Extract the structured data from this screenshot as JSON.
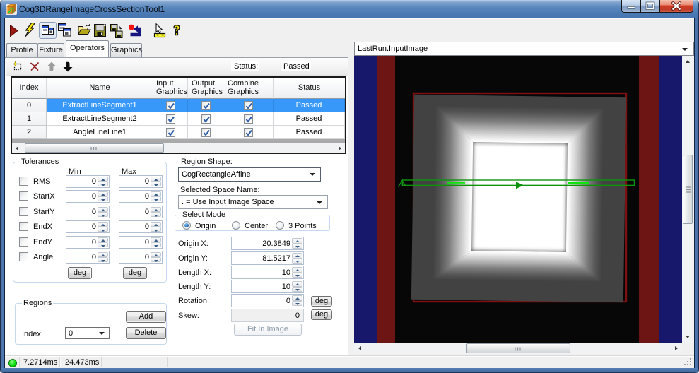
{
  "window": {
    "title": "Cog3DRangeImageCrossSectionTool1",
    "controls": [
      "minimize",
      "maximize",
      "close"
    ]
  },
  "toolbar": {
    "icons": [
      "run-icon",
      "electric-run-icon",
      "show-result-toggle-icon",
      "float-windows-icon",
      "open-icon",
      "save-icon",
      "save-as-icon",
      "reset-icon",
      "customize-toolbar-icon",
      "help-icon"
    ]
  },
  "tabs": {
    "items": [
      "Profile",
      "Fixture",
      "Operators",
      "Graphics"
    ],
    "selected": "Operators"
  },
  "operators_bar": {
    "icons": [
      "add-operator-icon",
      "delete-operator-icon",
      "move-up-icon",
      "move-down-icon"
    ],
    "status_label": "Status:",
    "status_value": "Passed"
  },
  "grid": {
    "columns": [
      "Index",
      "Name",
      "Input\nGraphics",
      "Output\nGraphics",
      "Combine\nGraphics",
      "Status"
    ],
    "rows": [
      {
        "index": "0",
        "name": "ExtractLineSegment1",
        "input_graphics": true,
        "output_graphics": true,
        "combine_graphics": true,
        "status": "Passed",
        "selected": true
      },
      {
        "index": "1",
        "name": "ExtractLineSegment2",
        "input_graphics": true,
        "output_graphics": true,
        "combine_graphics": true,
        "status": "Passed",
        "selected": false
      },
      {
        "index": "2",
        "name": "AngleLineLine1",
        "input_graphics": true,
        "output_graphics": true,
        "combine_graphics": true,
        "status": "Passed",
        "selected": false
      }
    ]
  },
  "tolerances": {
    "title": "Tolerances",
    "min_header": "Min",
    "max_header": "Max",
    "rows": [
      {
        "label": "RMS",
        "checked": false,
        "min": "0",
        "max": "0"
      },
      {
        "label": "StartX",
        "checked": false,
        "min": "0",
        "max": "0"
      },
      {
        "label": "StartY",
        "checked": false,
        "min": "0",
        "max": "0"
      },
      {
        "label": "EndX",
        "checked": false,
        "min": "0",
        "max": "0"
      },
      {
        "label": "EndY",
        "checked": false,
        "min": "0",
        "max": "0"
      },
      {
        "label": "Angle",
        "checked": false,
        "min": "0",
        "max": "0"
      }
    ],
    "min_deg_label": "deg",
    "max_deg_label": "deg"
  },
  "regions": {
    "title": "Regions",
    "index_label": "Index:",
    "index_value": "0",
    "add_label": "Add",
    "delete_label": "Delete"
  },
  "region_shape": {
    "label": "Region Shape:",
    "value": "CogRectangleAffine"
  },
  "space_name": {
    "label": "Selected Space Name:",
    "value": ". = Use Input Image Space"
  },
  "select_mode": {
    "title": "Select Mode",
    "options": [
      "Origin",
      "Center",
      "3 Points"
    ],
    "selected": "Origin"
  },
  "shape_fields": {
    "origin_x": {
      "label": "Origin X:",
      "value": "20.3849"
    },
    "origin_y": {
      "label": "Origin Y:",
      "value": "81.5217"
    },
    "length_x": {
      "label": "Length X:",
      "value": "10"
    },
    "length_y": {
      "label": "Length Y:",
      "value": "10"
    },
    "rotation": {
      "label": "Rotation:",
      "value": "0",
      "unit_label": "deg"
    },
    "skew": {
      "label": "Skew:",
      "value": "0",
      "unit_label": "deg"
    },
    "fit_button_label": "Fit In Image"
  },
  "display": {
    "image_selector": "LastRun.InputImage",
    "image_colors": {
      "background": "#070707",
      "stripe_blue": "#17176b",
      "stripe_red": "#6d1414",
      "square_base_gray": "#454545",
      "plateau_white": "#ffffff",
      "square_outline_red": "#7d1111",
      "overlay_green": "#0d940d",
      "overlay_handle_green": "#0ce60c"
    }
  },
  "statusbar": {
    "run_time": "7.2714ms",
    "total_time": "24.473ms"
  },
  "colors": {
    "titlebar_blue": "#4273ae",
    "selection_blue": "#3898f9",
    "status_led_green": "#00d800"
  }
}
